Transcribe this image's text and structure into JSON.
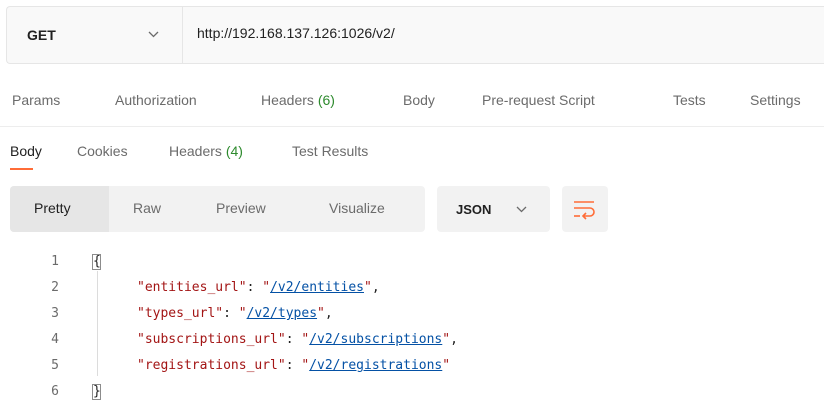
{
  "request": {
    "method": "GET",
    "url": "http://192.168.137.126:1026/v2/"
  },
  "request_tabs": [
    {
      "label": "Params",
      "count": ""
    },
    {
      "label": "Authorization",
      "count": ""
    },
    {
      "label": "Headers",
      "count": "(6)"
    },
    {
      "label": "Body",
      "count": ""
    },
    {
      "label": "Pre-request Script",
      "count": ""
    },
    {
      "label": "Tests",
      "count": ""
    },
    {
      "label": "Settings",
      "count": ""
    }
  ],
  "response_tabs": [
    {
      "label": "Body",
      "count": ""
    },
    {
      "label": "Cookies",
      "count": ""
    },
    {
      "label": "Headers",
      "count": "(4)"
    },
    {
      "label": "Test Results",
      "count": ""
    }
  ],
  "view_modes": [
    "Pretty",
    "Raw",
    "Preview",
    "Visualize"
  ],
  "format": "JSON",
  "colors": {
    "accent": "#ff6c37",
    "count_green": "#2d8a2d",
    "json_key": "#a31515",
    "json_link": "#0451a5"
  },
  "code": {
    "line_numbers": [
      "1",
      "2",
      "3",
      "4",
      "5",
      "6"
    ],
    "open_brace": "{",
    "close_brace": "}",
    "entries": [
      {
        "key": "\"entities_url\"",
        "value": "/v2/entities",
        "trail": ","
      },
      {
        "key": "\"types_url\"",
        "value": "/v2/types",
        "trail": ","
      },
      {
        "key": "\"subscriptions_url\"",
        "value": "/v2/subscriptions",
        "trail": ","
      },
      {
        "key": "\"registrations_url\"",
        "value": "/v2/registrations",
        "trail": ""
      }
    ]
  }
}
